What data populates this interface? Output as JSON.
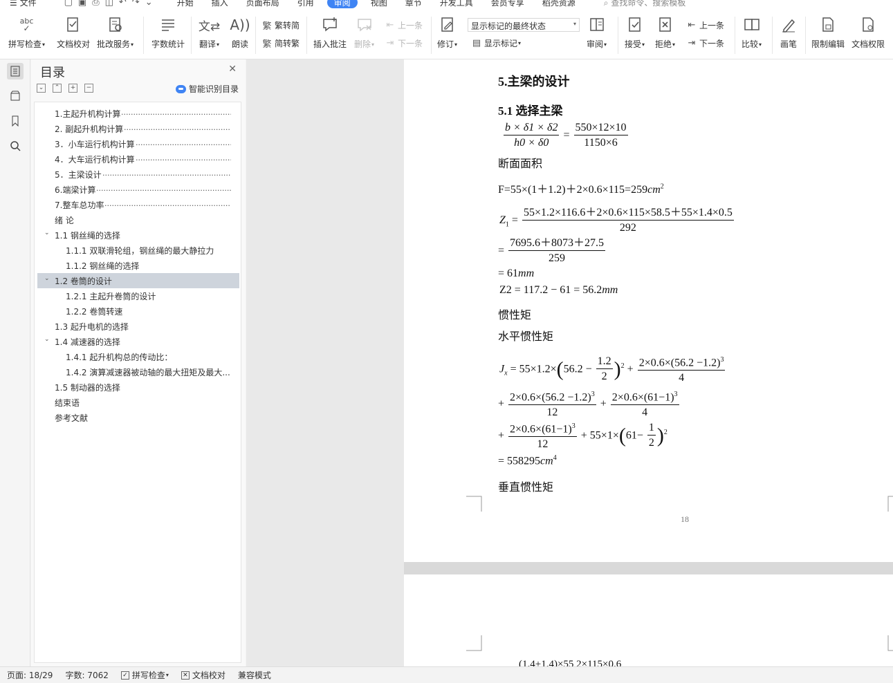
{
  "menubar": {
    "file": "文件",
    "tabs": [
      "开始",
      "插入",
      "页面布局",
      "引用",
      "审阅",
      "视图",
      "章节",
      "开发工具",
      "会员专享",
      "稻壳资源"
    ],
    "active_tab": "审阅",
    "search": "查找命令、搜索模板"
  },
  "ribbon": {
    "spellcheck": "拼写检查",
    "proofread": "文档校对",
    "grading": "批改服务",
    "wordcount": "字数统计",
    "translate": "翻译",
    "read_aloud": "朗读",
    "to_simplified": "繁转简",
    "to_traditional": "简转繁",
    "insert_comment": "插入批注",
    "delete": "删除",
    "prev": "上一条",
    "next": "下一条",
    "track_changes": "修订",
    "markup_state": "显示标记的最终状态",
    "show_markup": "显示标记",
    "review": "审阅",
    "accept": "接受",
    "reject": "拒绝",
    "prev_change": "上一条",
    "next_change": "下一条",
    "compare": "比较",
    "pen": "画笔",
    "restrict_edit": "限制编辑",
    "doc_permission": "文档权限"
  },
  "toc": {
    "title": "目录",
    "ai_label": "智能识别目录",
    "items": [
      {
        "text": "1.主起升机构计算",
        "level": 0,
        "dots": true
      },
      {
        "text": "2. 副起升机构计算",
        "level": 0,
        "dots": true
      },
      {
        "text": "3．小车运行机构计算",
        "level": 0,
        "dots": true
      },
      {
        "text": "4．大车运行机构计算",
        "level": 0,
        "dots": true
      },
      {
        "text": "5．主梁设计",
        "level": 0,
        "dots": true
      },
      {
        "text": "6.端梁计算",
        "level": 0,
        "dots": true
      },
      {
        "text": "7.整车总功率",
        "level": 0,
        "dots": true
      },
      {
        "text": "绪  论",
        "level": 0
      },
      {
        "text": "1.1 钢丝绳的选择",
        "level": 0,
        "expand": true
      },
      {
        "text": "1.1.1 双联滑轮组，钢丝绳的最大静拉力",
        "level": 1
      },
      {
        "text": "1.1.2 钢丝绳的选择",
        "level": 1
      },
      {
        "text": "1.2 卷筒的设计",
        "level": 0,
        "expand": true,
        "selected": true
      },
      {
        "text": "1.2.1 主起升卷筒的设计",
        "level": 1
      },
      {
        "text": "1.2.2 卷筒转速",
        "level": 1
      },
      {
        "text": "1.3 起升电机的选择",
        "level": 0
      },
      {
        "text": "1.4 减速器的选择",
        "level": 0,
        "expand": true
      },
      {
        "text": "1.4.1 起升机构总的传动比：",
        "level": 1
      },
      {
        "text": "1.4.2 演算减速器被动轴的最大扭矩及最大...",
        "level": 1
      },
      {
        "text": "1.5 制动器的选择",
        "level": 0
      },
      {
        "text": "结束语",
        "level": 0
      },
      {
        "text": "参考文献",
        "level": 0
      }
    ]
  },
  "doc": {
    "heading1": "5.主梁的设计",
    "heading2": "5.1 选择主梁",
    "ratio_lhs_num": "b × δ1 × δ2",
    "ratio_lhs_den": "h0 × δ0",
    "ratio_rhs_num": "550×12×10",
    "ratio_rhs_den": "1150×6",
    "section_area_label": "断面面积",
    "area_eq": "F=55×(1＋1.2)＋2×0.6×115=259",
    "area_unit": "cm",
    "z1_num": "55×1.2×116.6＋2×0.6×115×58.5＋55×1.4×0.5",
    "z1_den": "292",
    "z1_step_num": "7695.6＋8073＋27.5",
    "z1_step_den": "259",
    "z1_result": "= 61",
    "z1_unit": "mm",
    "z2_eq": "Z2 = 117.2 − 61 = 56.2",
    "z2_unit": "mm",
    "inertia_label": "惯性矩",
    "horizontal_inertia_label": "水平惯性矩",
    "jx_result": "= 558295",
    "jx_unit": "cm",
    "vertical_inertia_label": "垂直惯性矩",
    "page_number": "18",
    "next_page_partial": "(1.4+1.4)×55   2×115×0.6"
  },
  "status": {
    "page": "页面: 18/29",
    "wordcount": "字数: 7062",
    "spellcheck": "拼写检查",
    "proofread": "文档校对",
    "compat": "兼容模式"
  },
  "colors": {
    "accent": "#3f84f4",
    "toc_selected": "#ced4dc"
  }
}
